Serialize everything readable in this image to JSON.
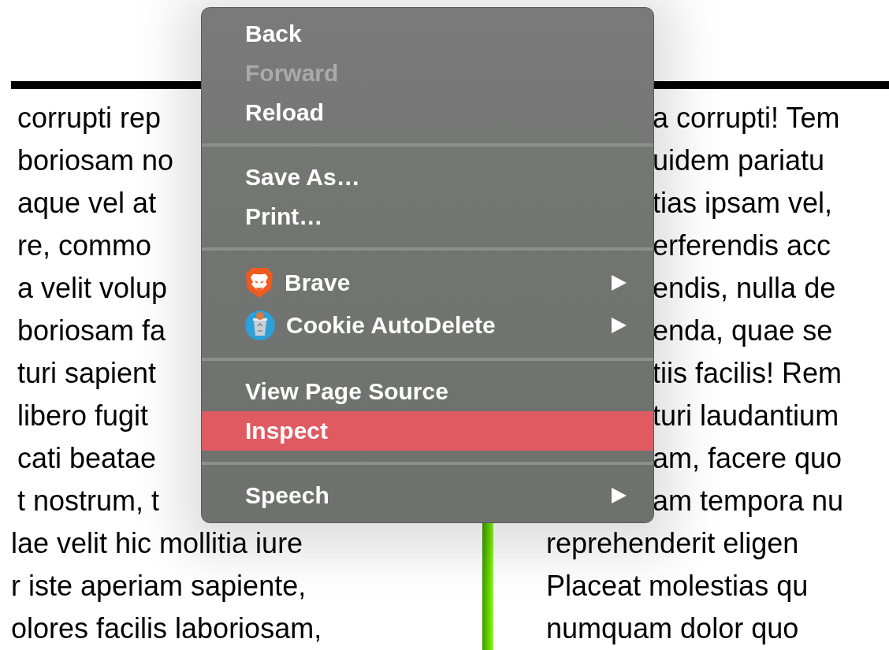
{
  "page": {
    "left_column": {
      "partly_hidden_lines": [
        "corrupti rep",
        "boriosam no",
        "aque vel at",
        "re, commo",
        "a velit volup",
        "boriosam fa",
        "turi sapient",
        "libero fugit",
        "cati beatae",
        "t nostrum, t"
      ],
      "lines": [
        "lae velit hic mollitia iure",
        "r iste aperiam sapiente,",
        "olores facilis laboriosam,"
      ]
    },
    "right_column": {
      "partly_hidden_lines": [
        "a corrupti! Tem",
        "uidem pariatu",
        "tias ipsam vel,",
        "erferendis acc",
        "endis, nulla de",
        "enda, quae se",
        "tiis facilis! Rem",
        "turi laudantium",
        "am, facere quo",
        "am tempora nu"
      ],
      "lines": [
        "reprehenderit eligen",
        "Placeat molestias qu",
        "numquam dolor quo"
      ]
    }
  },
  "context_menu": {
    "groups": [
      [
        {
          "label": "Back",
          "kind": "plain",
          "disabled": false,
          "selected": false,
          "submenu": false
        },
        {
          "label": "Forward",
          "kind": "plain",
          "disabled": true,
          "selected": false,
          "submenu": false
        },
        {
          "label": "Reload",
          "kind": "plain",
          "disabled": false,
          "selected": false,
          "submenu": false
        }
      ],
      [
        {
          "label": "Save As…",
          "kind": "plain",
          "disabled": false,
          "selected": false,
          "submenu": false
        },
        {
          "label": "Print…",
          "kind": "plain",
          "disabled": false,
          "selected": false,
          "submenu": false
        }
      ],
      [
        {
          "label": "Brave",
          "kind": "extension",
          "disabled": false,
          "selected": false,
          "submenu": true
        },
        {
          "label": "Cookie AutoDelete",
          "kind": "extension",
          "disabled": false,
          "selected": false,
          "submenu": true
        }
      ],
      [
        {
          "label": "View Page Source",
          "kind": "plain",
          "disabled": false,
          "selected": false,
          "submenu": false
        },
        {
          "label": "Inspect",
          "kind": "plain",
          "disabled": false,
          "selected": true,
          "submenu": false
        }
      ],
      [
        {
          "label": "Speech",
          "kind": "plain",
          "disabled": false,
          "selected": false,
          "submenu": true
        }
      ]
    ]
  }
}
